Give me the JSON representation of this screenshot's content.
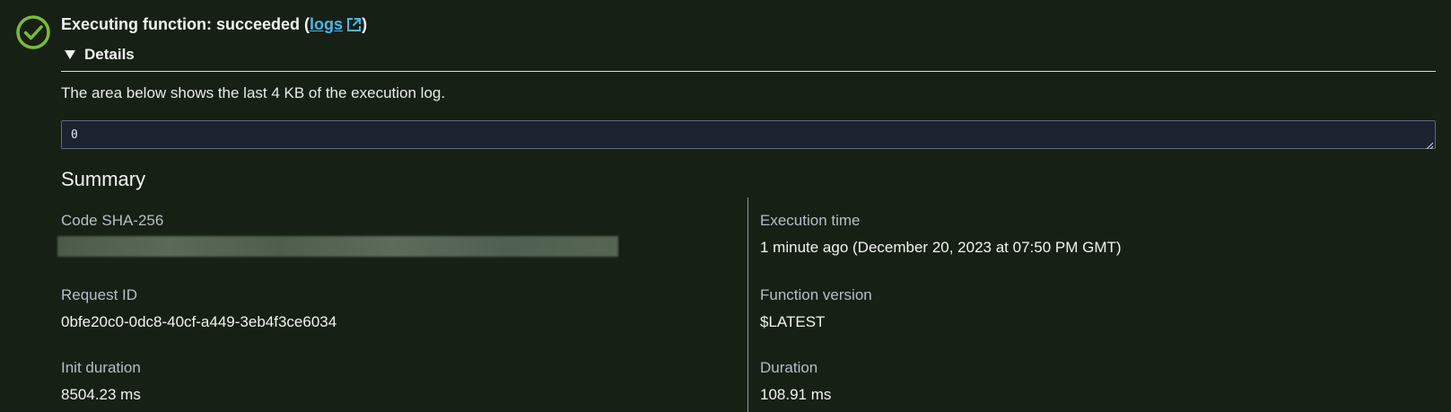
{
  "header": {
    "prefix": "Executing function: succeeded (",
    "logs_label": "logs",
    "suffix": ")",
    "status_icon": "check-circle-icon",
    "status_color": "#7cbc34"
  },
  "details": {
    "toggle_label": "Details",
    "caption": "The area below shows the last 4 KB of the execution log.",
    "log_value": "0"
  },
  "summary": {
    "title": "Summary",
    "left": [
      {
        "label": "Code SHA-256",
        "value": ""
      },
      {
        "label": "Request ID",
        "value": "0bfe20c0-0dc8-40cf-a449-3eb4f3ce6034"
      },
      {
        "label": "Init duration",
        "value": "8504.23 ms"
      }
    ],
    "right": [
      {
        "label": "Execution time",
        "value": "1 minute ago (December 20, 2023 at 07:50 PM GMT)"
      },
      {
        "label": "Function version",
        "value": "$LATEST"
      },
      {
        "label": "Duration",
        "value": "108.91 ms"
      }
    ]
  },
  "colors": {
    "background": "#172014",
    "link": "#49b6e8",
    "log_background": "#1b2230"
  }
}
